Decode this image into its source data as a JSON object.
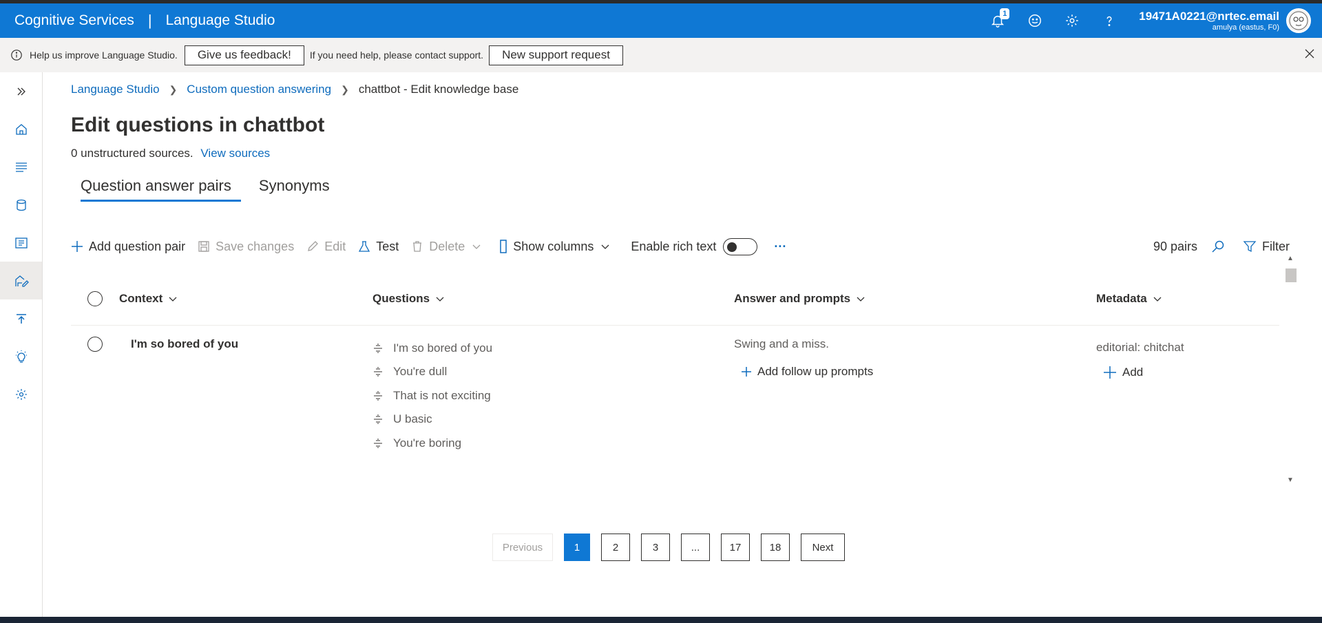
{
  "topbar": {
    "brand": "Cognitive Services",
    "separator": "|",
    "app": "Language Studio",
    "notification_count": "1",
    "account_email": "19471A0221@nrtec.email",
    "account_sub": "amulya (eastus, F0)"
  },
  "notice": {
    "text": "Help us improve Language Studio.",
    "feedback_btn": "Give us feedback!",
    "help_text": "If you need help, please contact support.",
    "support_btn": "New support request"
  },
  "breadcrumb": {
    "items": [
      "Language Studio",
      "Custom question answering",
      "chattbot - Edit knowledge base"
    ]
  },
  "page": {
    "title": "Edit questions in chattbot",
    "sources_text": "0 unstructured sources.",
    "view_sources": "View sources"
  },
  "tabs": [
    {
      "label": "Question answer pairs",
      "active": true
    },
    {
      "label": "Synonyms",
      "active": false
    }
  ],
  "toolbar": {
    "add": "Add question pair",
    "save": "Save changes",
    "edit": "Edit",
    "test": "Test",
    "delete": "Delete",
    "show_columns": "Show columns",
    "rich_text": "Enable rich text",
    "more": "···",
    "pairs": "90 pairs",
    "filter": "Filter"
  },
  "grid": {
    "headers": {
      "context": "Context",
      "questions": "Questions",
      "answer": "Answer and prompts",
      "metadata": "Metadata"
    },
    "rows": [
      {
        "context": "I'm so bored of you",
        "questions": [
          "I'm so bored of you",
          "You're dull",
          "That is not exciting",
          "U basic",
          "You're boring"
        ],
        "answer": "Swing and a miss.",
        "add_prompts": "Add follow up prompts",
        "metadata": "editorial: chitchat",
        "add_meta": "Add"
      }
    ]
  },
  "pager": {
    "previous": "Previous",
    "pages": [
      "1",
      "2",
      "3",
      "...",
      "17",
      "18"
    ],
    "current": "1",
    "next": "Next"
  },
  "colors": {
    "accent": "#0f78d4",
    "link": "#0f6cbd"
  }
}
